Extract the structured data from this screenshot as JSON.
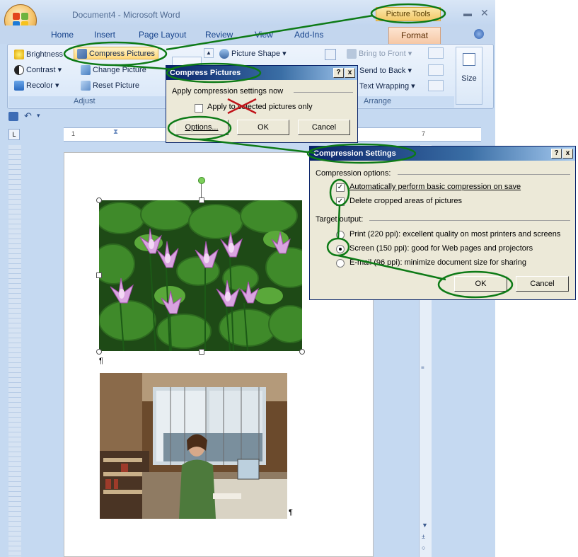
{
  "window": {
    "title": "Document4 - Microsoft Word",
    "contextual_tab_group": "Picture Tools"
  },
  "tabs": [
    "Home",
    "Insert",
    "Page Layout",
    "Review",
    "View",
    "Add-Ins",
    "Format"
  ],
  "ribbon": {
    "adjust": {
      "brightness": "Brightness",
      "contrast": "Contrast",
      "recolor": "Recolor",
      "compress": "Compress Pictures",
      "change": "Change Picture",
      "reset": "Reset Picture",
      "group_label": "Adjust"
    },
    "picture_shape": "Picture Shape",
    "arrange": {
      "bring_to_front": "Bring to Front",
      "send_to_back": "Send to Back",
      "text_wrapping": "Text Wrapping",
      "group_label": "Arrange"
    },
    "size_label": "Size"
  },
  "compress_dialog": {
    "title": "Compress Pictures",
    "help": "?",
    "close": "x",
    "section": "Apply compression settings now",
    "checkbox_label": "Apply to selected pictures only",
    "checkbox_checked": false,
    "options_button": "Options...",
    "ok_button": "OK",
    "cancel_button": "Cancel"
  },
  "settings_dialog": {
    "title": "Compression Settings",
    "help": "?",
    "close": "x",
    "compression_options_label": "Compression options:",
    "auto_compress_label": "Automatically perform basic compression on save",
    "auto_compress_checked": true,
    "delete_cropped_label": "Delete cropped areas of pictures",
    "delete_cropped_checked": true,
    "target_output_label": "Target output:",
    "options": [
      {
        "label": "Print (220 ppi): excellent quality on most printers and screens",
        "selected": false
      },
      {
        "label": "Screen (150 ppi): good for Web pages and projectors",
        "selected": true
      },
      {
        "label": "E-mail (96 ppi): minimize document size for sharing",
        "selected": false
      }
    ],
    "ok_button": "OK",
    "cancel_button": "Cancel"
  },
  "ruler_marks": [
    "1",
    "1",
    "7"
  ],
  "pilcrow": "¶",
  "colors": {
    "annotation_green": "#0d7a16",
    "dialog_title": "#0a246a",
    "ribbon_bg": "#d7e6f8"
  }
}
